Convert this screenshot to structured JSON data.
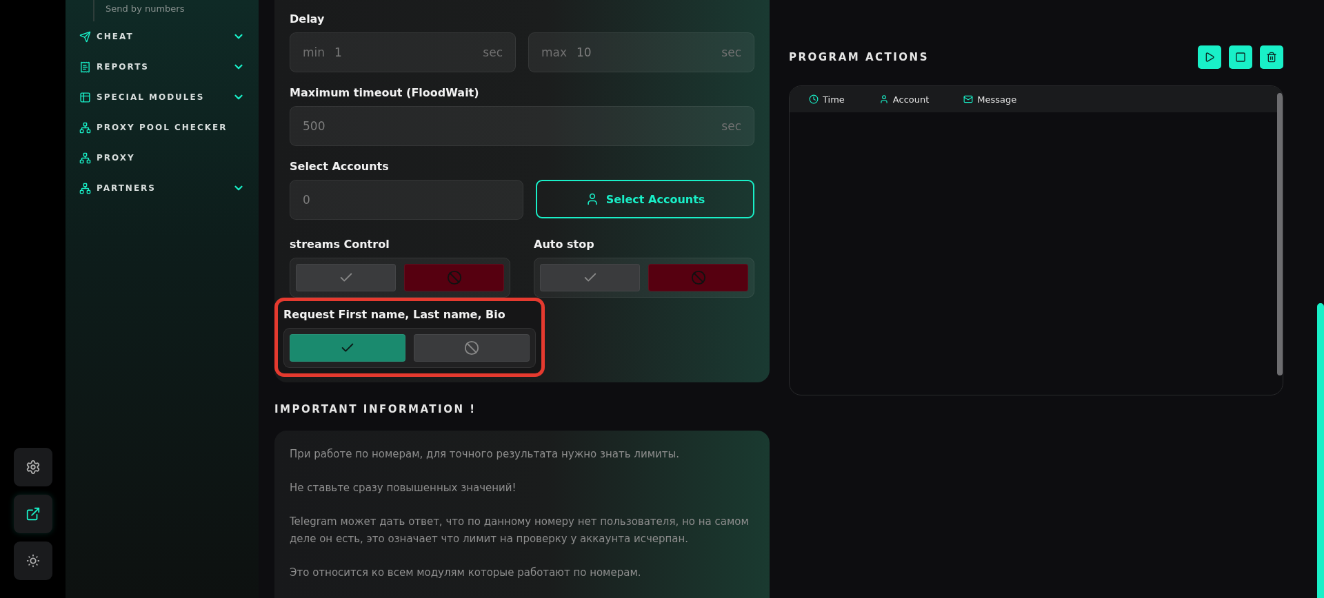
{
  "rail": [
    {
      "kind": "settings",
      "selected": false
    },
    {
      "kind": "external",
      "selected": true
    },
    {
      "kind": "theme",
      "selected": false
    }
  ],
  "sidebar": {
    "sub_item": "Send by numbers",
    "items": [
      {
        "label": "CHEAT",
        "kind": "send",
        "expanded": false
      },
      {
        "label": "REPORTS",
        "kind": "report",
        "expanded": false
      },
      {
        "label": "SPECIAL MODULES",
        "kind": "table",
        "expanded": false
      },
      {
        "label": "PROXY POOL CHECKER",
        "kind": "network"
      },
      {
        "label": "PROXY",
        "kind": "network"
      },
      {
        "label": "PARTNERS",
        "kind": "network",
        "expanded": false
      }
    ]
  },
  "form": {
    "delay": {
      "label": "Delay",
      "fields": [
        {
          "prefix": "min",
          "value": "1",
          "suffix": "sec"
        },
        {
          "prefix": "max",
          "value": "10",
          "suffix": "sec"
        }
      ]
    },
    "timeout": {
      "label": "Maximum timeout (FloodWait)",
      "value": "500",
      "suffix": "sec"
    },
    "accounts": {
      "label": "Select Accounts",
      "value": "0",
      "button": "Select Accounts"
    },
    "toggles": [
      {
        "label": "streams Control",
        "on": false,
        "highlighted": false
      },
      {
        "label": "Auto stop",
        "on": false,
        "highlighted": false
      },
      {
        "label": "Request First name, Last name, Bio",
        "on": true,
        "highlighted": true
      }
    ]
  },
  "info": {
    "title": "IMPORTANT INFORMATION !",
    "paragraphs": [
      "При работе по номерам, для точного результата нужно знать лимиты.",
      "Не ставьте сразу повышенных значений!",
      "Telegram может дать ответ, что по данному номеру нет пользователя, но на самом деле он есть, это означает что лимит на проверку у аккаунта исчерпан.",
      "Это относится ко всем модулям которые работают по номерам."
    ]
  },
  "actions": {
    "title": "PROGRAM ACTIONS",
    "buttons": [
      {
        "kind": "play"
      },
      {
        "kind": "stop"
      },
      {
        "kind": "delete"
      }
    ],
    "columns": [
      {
        "label": "Time",
        "kind": "time"
      },
      {
        "label": "Account",
        "kind": "account"
      },
      {
        "label": "Message",
        "kind": "message"
      }
    ]
  }
}
